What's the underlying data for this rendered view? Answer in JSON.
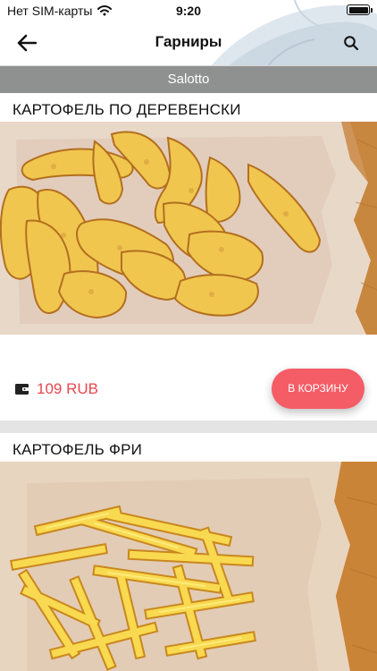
{
  "status_bar": {
    "carrier": "Нет SIM-карты",
    "time": "9:20",
    "wifi_icon": "wifi-icon",
    "battery_icon": "battery-icon"
  },
  "header": {
    "title": "Гарниры",
    "back_icon": "arrow-left-icon",
    "search_icon": "search-icon"
  },
  "restaurant": {
    "name": "Salotto",
    "bar_color": "#8f9190"
  },
  "products": [
    {
      "title": "КАРТОФЕЛЬ ПО ДЕРЕВЕНСКИ",
      "image": "potato-wedges-photo",
      "price": "109 RUB",
      "price_icon": "wallet-icon",
      "cart_label": "В КОРЗИНУ"
    },
    {
      "title": "КАРТОФЕЛЬ ФРИ",
      "image": "french-fries-photo"
    }
  ],
  "colors": {
    "accent": "#f45d66",
    "price": "#e8474f",
    "separator": "#e4e4e4"
  }
}
